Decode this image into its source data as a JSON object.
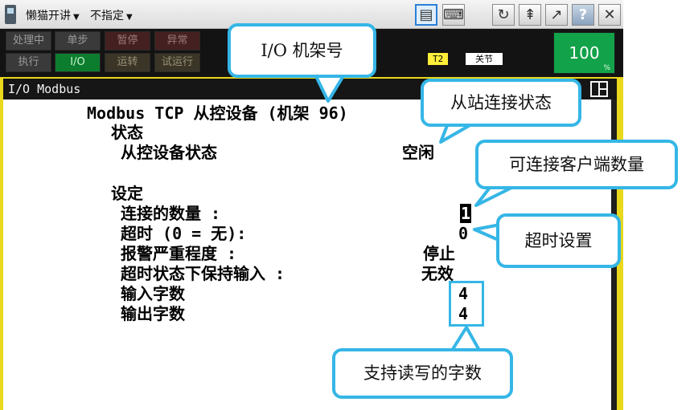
{
  "topbar": {
    "menu_left": "懒猫开讲",
    "menu_right": "不指定"
  },
  "status": {
    "row1": [
      "处理中",
      "单步",
      "暂停",
      "异常"
    ],
    "row2": [
      "执行",
      "I/O",
      "运转",
      "试运行"
    ],
    "badge_t2": "T2",
    "badge_state": "关节",
    "speed": "100",
    "speed_unit": "%"
  },
  "screen": {
    "title": "I/O Modbus",
    "heading": "Modbus TCP 从控设备 (机架 96)",
    "status_section": "状态",
    "slave_status_label": "从控设备状态",
    "slave_status_value": "空闲",
    "settings_section": "设定",
    "fields": [
      {
        "label": "连接的数量    :",
        "value": "1"
      },
      {
        "label": "超时  (0 = 无):",
        "value": "0"
      },
      {
        "label": "报警严重程度    :",
        "value": "停止"
      },
      {
        "label": "超时状态下保持输入 :",
        "value": "无效"
      },
      {
        "label": "输入字数",
        "value": "4"
      },
      {
        "label": "输出字数",
        "value": "4"
      }
    ]
  },
  "callouts": {
    "rack": "I/O 机架号",
    "slave_status": "从站连接状态",
    "client_count": "可连接客户端数量",
    "timeout": "超时设置",
    "word_count": "支持读写的字数"
  },
  "colors": {
    "callout_border": "#35b6e6",
    "screen_frame": "#e9d81c",
    "speed_bg": "#12a24a"
  }
}
